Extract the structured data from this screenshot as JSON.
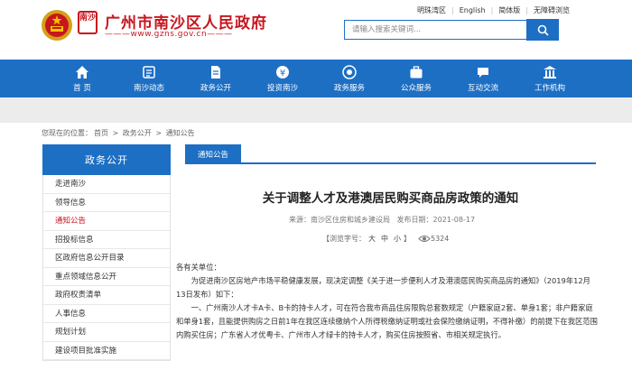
{
  "header": {
    "site_title": "广州市南沙区人民政府",
    "site_url": "www.gzns.gov.cn",
    "logo_text": "南沙",
    "top_links": [
      "明珠湾区",
      "English",
      "简体版",
      "无障碍浏览"
    ],
    "search_placeholder": "请输入搜索关键词..."
  },
  "nav": {
    "items": [
      {
        "label": "首 页",
        "icon": "home-icon"
      },
      {
        "label": "南沙动态",
        "icon": "news-icon"
      },
      {
        "label": "政务公开",
        "icon": "document-icon"
      },
      {
        "label": "投资南沙",
        "icon": "investment-icon"
      },
      {
        "label": "政务服务",
        "icon": "service-icon"
      },
      {
        "label": "公众服务",
        "icon": "briefcase-icon"
      },
      {
        "label": "互动交流",
        "icon": "chat-icon"
      },
      {
        "label": "工作机构",
        "icon": "building-icon"
      }
    ]
  },
  "breadcrumb": {
    "prefix": "您现在的位置：",
    "items": [
      "首页",
      "政务公开",
      "通知公告"
    ],
    "separator": ">"
  },
  "sidebar": {
    "title": "政务公开",
    "items": [
      {
        "label": "走进南沙"
      },
      {
        "label": "领导信息"
      },
      {
        "label": "通知公告"
      },
      {
        "label": "招投标信息"
      },
      {
        "label": "区政府信息公开目录"
      },
      {
        "label": "重点领域信息公开"
      },
      {
        "label": "政府权责清单"
      },
      {
        "label": "人事信息"
      },
      {
        "label": "规划计划"
      },
      {
        "label": "建设项目批准实施"
      }
    ]
  },
  "article": {
    "tab_label": "通知公告",
    "title": "关于调整人才及港澳居民购买商品房政策的通知",
    "source": "来源：南沙区住房和城乡建设局",
    "date": "发布日期：2021-08-17",
    "fontsize_label": "【浏览字号：",
    "fontsize_options": [
      "大",
      "中",
      "小"
    ],
    "fontsize_close": "】",
    "views": "5324",
    "salutation": "各有关单位：",
    "paragraphs": [
      "为促进南沙区房地产市场平稳健康发展，现决定调整《关于进一步便利人才及港澳居民购买商品房的通知》（2019年12月13日发布）如下：",
      "一、广州南沙人才卡A卡、B卡的持卡人才，可在符合我市商品住房限购总套数规定（户籍家庭2套、单身1套；非户籍家庭和单身1套，且能提供购房之日前1年在我区连续缴纳个人所得税缴纳证明或社会保险缴纳证明，不得补缴）的前提下在我区范围内购买住房；广东省人才优粤卡、广州市人才绿卡的持卡人才，购买住房按照省、市相关规定执行。"
    ]
  },
  "colors": {
    "brand_red": "#c8161e",
    "brand_blue": "#1d6fc4",
    "band_gray": "#ececec"
  }
}
